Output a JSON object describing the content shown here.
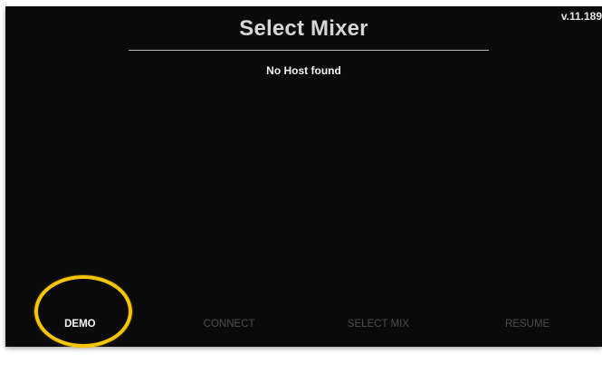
{
  "header": {
    "version": "v.11.189",
    "title": "Select Mixer"
  },
  "status": {
    "message": "No Host found"
  },
  "bottom_bar": {
    "buttons": [
      {
        "label": "DEMO",
        "state": "active"
      },
      {
        "label": "CONNECT",
        "state": "disabled"
      },
      {
        "label": "SELECT MIX",
        "state": "disabled"
      },
      {
        "label": "RESUME",
        "state": "disabled"
      }
    ]
  },
  "colors": {
    "background": "#0a0a0a",
    "highlight": "#f5c400",
    "active_text": "#f4f4f4",
    "disabled_text": "#4d4d4d"
  }
}
